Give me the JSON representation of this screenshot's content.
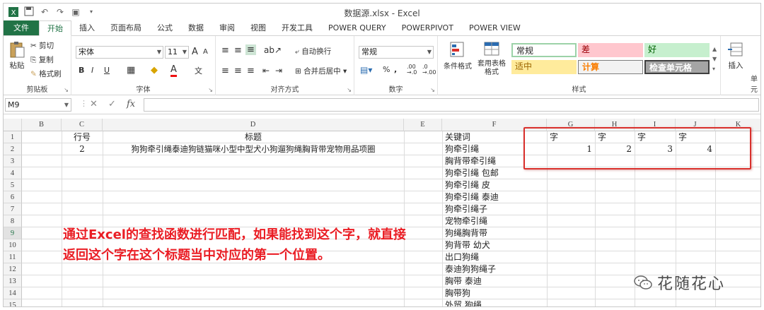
{
  "window": {
    "title": "数据源.xlsx - Excel"
  },
  "tabs": [
    {
      "label": "文件"
    },
    {
      "label": "开始"
    },
    {
      "label": "插入"
    },
    {
      "label": "页面布局"
    },
    {
      "label": "公式"
    },
    {
      "label": "数据"
    },
    {
      "label": "审阅"
    },
    {
      "label": "视图"
    },
    {
      "label": "开发工具"
    },
    {
      "label": "POWER QUERY"
    },
    {
      "label": "POWERPIVOT"
    },
    {
      "label": "POWER VIEW"
    }
  ],
  "ribbon": {
    "clipboard": {
      "paste": "粘贴",
      "cut": "剪切",
      "copy": "复制",
      "format_painter": "格式刷",
      "label": "剪贴板"
    },
    "font": {
      "name": "宋体",
      "size": "11",
      "label": "字体",
      "bold": "B",
      "italic": "I",
      "underline": "U",
      "grow": "A",
      "shrink": "A",
      "color": "A",
      "phonetic": "文"
    },
    "alignment": {
      "wrap": "自动换行",
      "merge": "合并后居中",
      "label": "对齐方式"
    },
    "number": {
      "format": "常规",
      "percent": "%",
      "comma": ",",
      "label": "数字"
    },
    "styles": {
      "conditional": "条件格式",
      "table_format": "套用表格格式",
      "label": "样式",
      "normal": "常规",
      "bad": "差",
      "good": "好",
      "neutral": "适中",
      "calculation": "计算",
      "check": "检查单元格"
    },
    "cells": {
      "insert": "插入",
      "label": "单元"
    }
  },
  "formula_bar": {
    "name_box": "M9",
    "fx": "fx",
    "content": ""
  },
  "grid": {
    "columns": [
      "B",
      "C",
      "D",
      "E",
      "F",
      "G",
      "H",
      "I",
      "J",
      "K"
    ],
    "rows": [
      "1",
      "2",
      "3",
      "4",
      "5",
      "6",
      "7",
      "8",
      "9",
      "10",
      "11",
      "12",
      "13",
      "14",
      "15"
    ],
    "c1": "行号",
    "c2": "2",
    "d1": "标题",
    "d2": "狗狗牵引绳泰迪狗链猫咪小型中型犬小狗遛狗绳胸背带宠物用品项圈",
    "f_values": [
      "关键词",
      "狗牵引绳",
      "胸背带牵引绳",
      "狗牵引绳 包邮",
      "狗牵引绳 皮",
      "狗牵引绳 泰迪",
      "狗牵引绳子",
      "宠物牵引绳",
      "狗绳胸背带",
      "狗背带 幼犬",
      "出口狗绳",
      "泰迪狗狗绳子",
      "胸带 泰迪",
      "胸带狗",
      "外贸 狗绳"
    ],
    "row1_gj": [
      "字",
      "字",
      "字",
      "字"
    ],
    "row2_gj": [
      "1",
      "2",
      "3",
      "4"
    ]
  },
  "annotation": "通过Excel的查找函数进行匹配，如果能找到这个字，就直接返回这个字在这个标题当中对应的第一个位置。",
  "watermark": "花随花心",
  "colors": {
    "accent": "#217346",
    "red": "#d9302c",
    "annotation": "#ea1d24"
  }
}
